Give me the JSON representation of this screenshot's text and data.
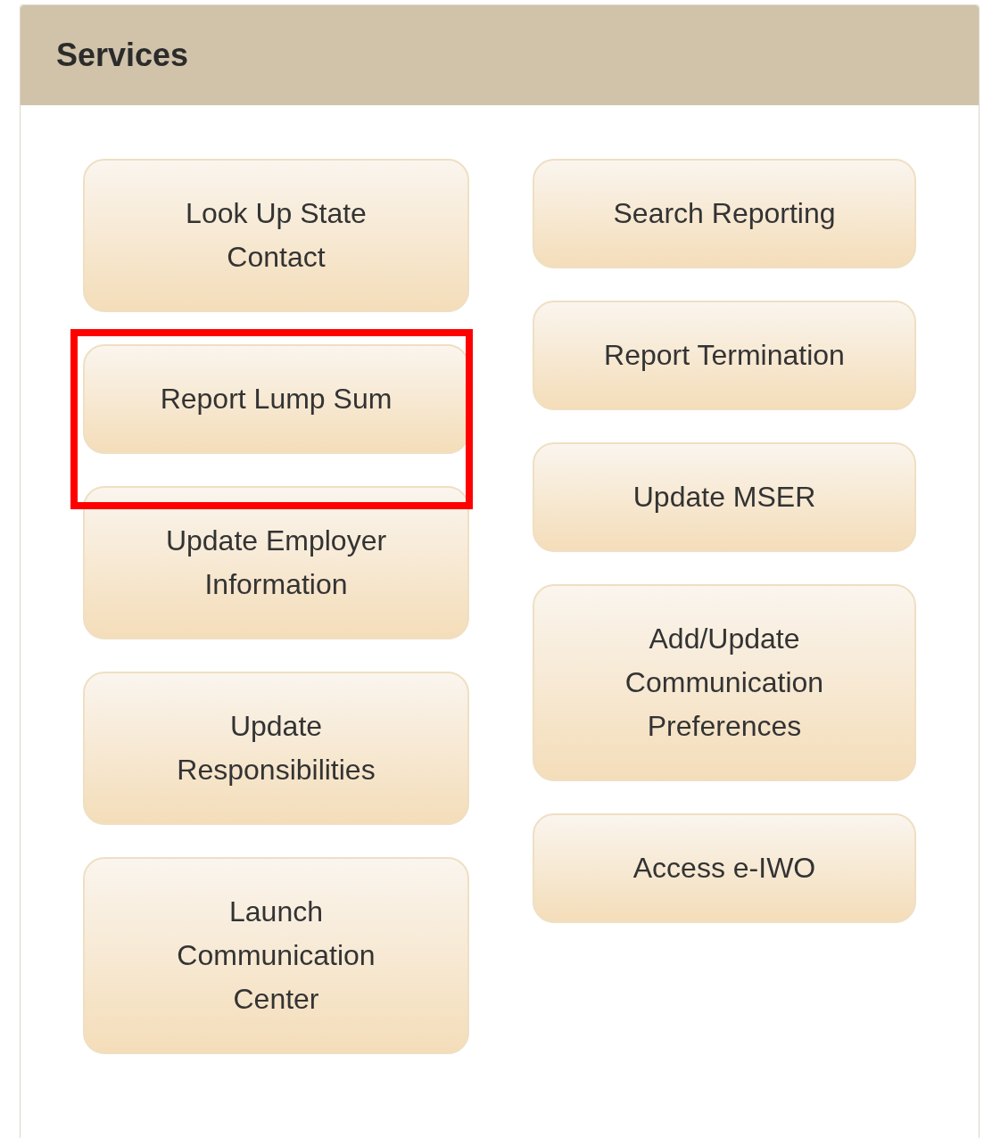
{
  "panel": {
    "title": "Services"
  },
  "columns": [
    [
      {
        "label": "Look Up State\nContact",
        "highlighted": false
      },
      {
        "label": "Report Lump Sum",
        "highlighted": true
      },
      {
        "label": "Update Employer\nInformation",
        "highlighted": false
      },
      {
        "label": "Update\nResponsibilities",
        "highlighted": false
      },
      {
        "label": "Launch\nCommunication\nCenter",
        "highlighted": false
      }
    ],
    [
      {
        "label": "Search Reporting",
        "highlighted": false
      },
      {
        "label": "Report Termination",
        "highlighted": false
      },
      {
        "label": "Update MSER",
        "highlighted": false
      },
      {
        "label": "Add/Update\nCommunication\nPreferences",
        "highlighted": false
      },
      {
        "label": "Access e-IWO",
        "highlighted": false
      }
    ]
  ]
}
